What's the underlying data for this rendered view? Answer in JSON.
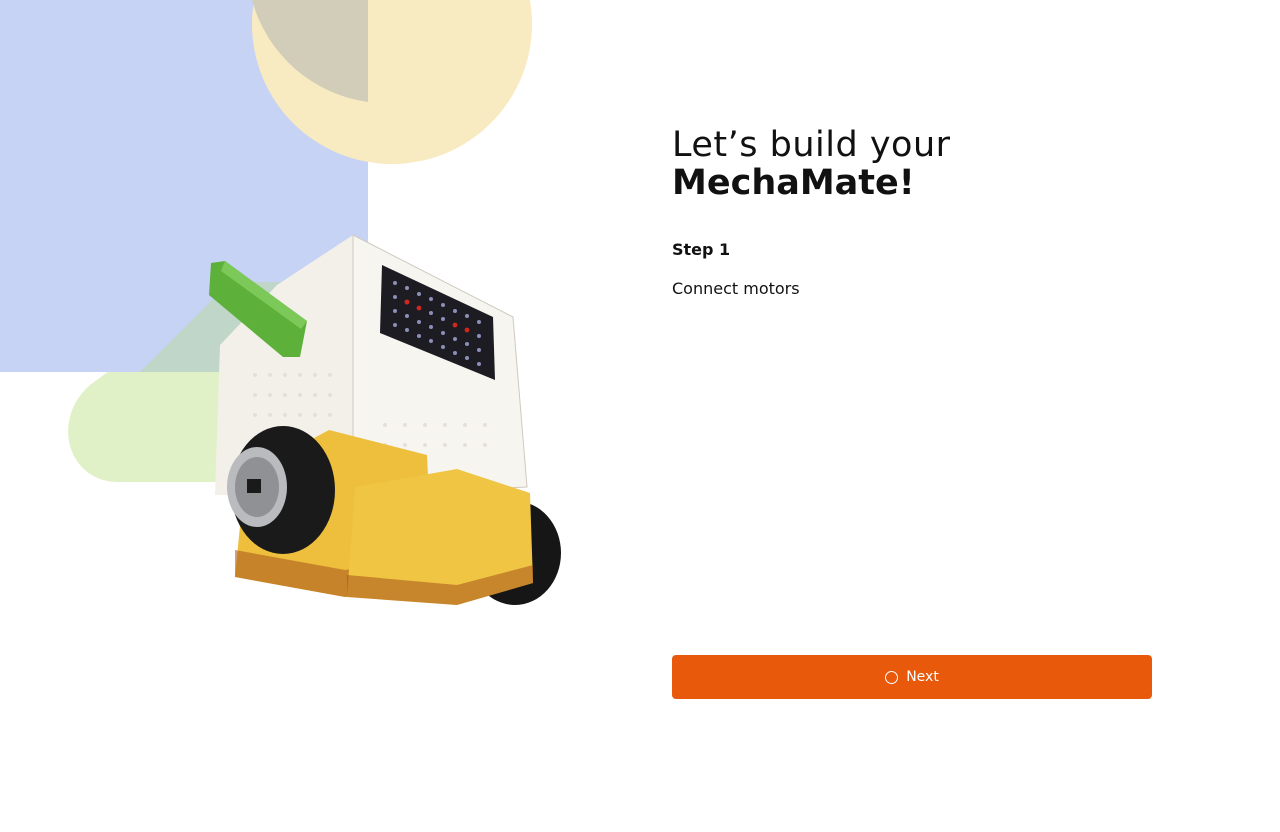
{
  "header": {
    "title_line1": "Let’s build your",
    "title_line2": "MechaMate!"
  },
  "step": {
    "label": "Step 1",
    "description": "Connect motors"
  },
  "actions": {
    "next_label": "Next",
    "next_icon": "spinner-icon"
  },
  "colors": {
    "accent": "#E8590C",
    "deco_blue": "#C7D3F4",
    "deco_yellow": "#F8EAC1",
    "deco_green": "#E0F1C8"
  },
  "illustration": {
    "icon": "robot-illustration"
  }
}
